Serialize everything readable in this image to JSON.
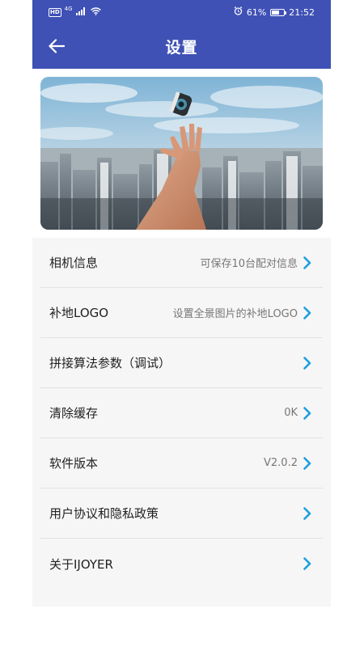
{
  "status_bar": {
    "hd": "HD",
    "network": "4G",
    "battery_text": "61%",
    "battery_level": 0.61,
    "time": "21:52"
  },
  "app_bar": {
    "title": "设置",
    "back_icon": "arrow-left-icon"
  },
  "banner": {
    "description_icon": "camera-city-banner"
  },
  "settings": {
    "items": [
      {
        "label": "相机信息",
        "value": "可保存10台配对信息"
      },
      {
        "label": "补地LOGO",
        "value": "设置全景图片的补地LOGO"
      },
      {
        "label": "拼接算法参数（调试）",
        "value": ""
      },
      {
        "label": "清除缓存",
        "value": "0K"
      },
      {
        "label": "软件版本",
        "value": "V2.0.2"
      },
      {
        "label": "用户协议和隐私政策",
        "value": ""
      },
      {
        "label": "关于IJOYER",
        "value": ""
      }
    ]
  },
  "colors": {
    "primary": "#3f51b5",
    "chevron": "#1e9fe0",
    "background": "#f6f6f6"
  }
}
